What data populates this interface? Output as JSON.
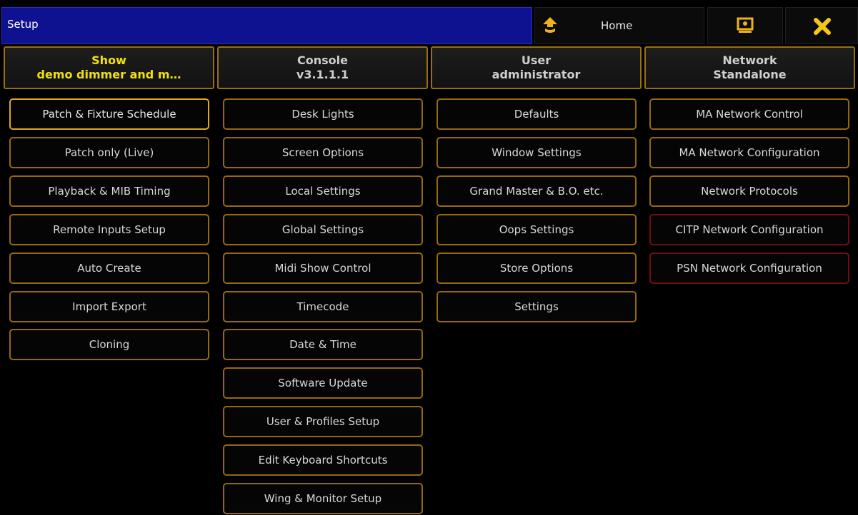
{
  "titlebar": {
    "title": "Setup"
  },
  "header": {
    "home_label": "Home",
    "icons": {
      "home": "home-up-arrow-icon",
      "screen": "screen-icon",
      "close": "close-x-icon"
    }
  },
  "colors": {
    "titlebar_bg": "#0f1290",
    "button_border": "#97680e",
    "button_border_selected": "#e0a820",
    "button_border_error": "#6e0f0f",
    "active_header_text": "#f3e10a",
    "close_icon": "#f5c518"
  },
  "columns": [
    {
      "header": [
        "Show",
        "demo dimmer and m…"
      ],
      "active": true,
      "buttons": [
        "Patch & Fixture Schedule",
        "Patch only (Live)",
        "Playback & MIB Timing",
        "Remote Inputs Setup",
        "Auto Create",
        "Import Export",
        "Cloning"
      ]
    },
    {
      "header": [
        "Console",
        "v3.1.1.1"
      ],
      "active": false,
      "buttons": [
        "Desk Lights",
        "Screen Options",
        "Local Settings",
        "Global Settings",
        "Midi Show Control",
        "Timecode",
        "Date & Time",
        "Software Update",
        "User & Profiles Setup",
        "Edit Keyboard Shortcuts",
        "Wing & Monitor Setup"
      ]
    },
    {
      "header": [
        "User",
        "administrator"
      ],
      "active": false,
      "buttons": [
        "Defaults",
        "Window Settings",
        "Grand Master & B.O. etc.",
        "Oops Settings",
        "Store Options",
        "Settings"
      ]
    },
    {
      "header": [
        "Network",
        "Standalone"
      ],
      "active": false,
      "buttons": [
        "MA Network Control",
        "MA Network Configuration",
        "Network Protocols",
        "CITP Network Configuration",
        "PSN Network Configuration"
      ]
    }
  ],
  "states": {
    "selected_button": "Patch & Fixture Schedule",
    "warning_buttons": [
      "CITP Network Configuration",
      "PSN Network Configuration"
    ]
  }
}
